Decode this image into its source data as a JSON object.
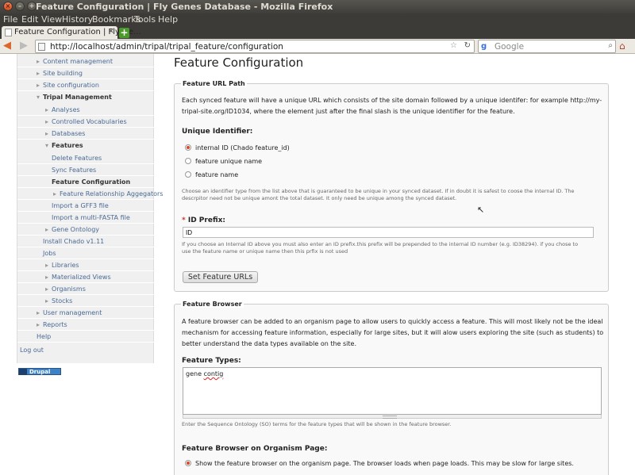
{
  "window": {
    "title": "Feature Configuration | Fly Genes Database - Mozilla Firefox"
  },
  "menu": [
    "File",
    "Edit",
    "View",
    "History",
    "Bookmarks",
    "Tools",
    "Help"
  ],
  "tab": {
    "title": "Feature Configuration | Fly Ge...",
    "close": "×",
    "new_tab": "+"
  },
  "nav": {
    "url": "http://localhost/admin/tripal/tripal_feature/configuration",
    "search_placeholder": "Google"
  },
  "sidebar": {
    "items": [
      {
        "label": "Content management",
        "arrow": "▸"
      },
      {
        "label": "Site building",
        "arrow": "▸"
      },
      {
        "label": "Site configuration",
        "arrow": "▸"
      },
      {
        "label": "Tripal Management",
        "arrow": "▾"
      },
      {
        "label": "Analyses",
        "arrow": "▸"
      },
      {
        "label": "Controlled Vocabularies",
        "arrow": "▸"
      },
      {
        "label": "Databases",
        "arrow": "▸"
      },
      {
        "label": "Features",
        "arrow": "▾"
      },
      {
        "label": "Delete Features"
      },
      {
        "label": "Sync Features"
      },
      {
        "label": "Feature Configuration"
      },
      {
        "label": "Feature Relationship Aggegators",
        "arrow": "▸"
      },
      {
        "label": "Import a GFF3 file"
      },
      {
        "label": "Import a multi-FASTA file"
      },
      {
        "label": "Gene Ontology",
        "arrow": "▸"
      },
      {
        "label": "Install Chado v1.11"
      },
      {
        "label": "Jobs"
      },
      {
        "label": "Libraries",
        "arrow": "▸"
      },
      {
        "label": "Materialized Views",
        "arrow": "▸"
      },
      {
        "label": "Organisms",
        "arrow": "▸"
      },
      {
        "label": "Stocks",
        "arrow": "▸"
      },
      {
        "label": "User management",
        "arrow": "▸"
      },
      {
        "label": "Reports",
        "arrow": "▸"
      },
      {
        "label": "Help"
      },
      {
        "label": "Log out"
      }
    ],
    "badge": "Drupal"
  },
  "page": {
    "title": "Feature Configuration"
  },
  "url_path": {
    "legend": "Feature URL Path",
    "intro_1": "Each synced feature will have a unique URL which consists of the site domain followed by a unique identifer: for example http://my-",
    "intro_2": "tripal-site.org/ID1034, where the element just after the final slash is the unique identifier for the feature.",
    "uid_label": "Unique Identifier:",
    "options": [
      "internal ID (Chado feature_id)",
      "feature unique name",
      "feature name"
    ],
    "uid_desc_1": "Choose an identifier type from the list above that is guaranteed to be unique in your synced dataset. If in doubt it is safest to coose the internal ID. The",
    "uid_desc_2": "descrpitor need not be unique amont the total dataset. It only need be unique among the synced dataset.",
    "prefix_required": "*",
    "prefix_label": "ID Prefix:",
    "prefix_value": "ID",
    "prefix_desc_1": "If you choose an Internal ID above you must also enter an ID prefix.this prefix will be prepended to the internal ID number (e.g. ID38294). if you chose to",
    "prefix_desc_2": "use the feature name or unique name then this prfix is not used",
    "button": "Set Feature URLs"
  },
  "browser": {
    "legend": "Feature Browser",
    "intro_1": "A feature browser can be added to an organism page to allow users to quickly access a feature. This will most likely not be the ideal",
    "intro_2": "mechanism for accessing feature information, especially for large sites, but it will alow users exploring the site (such as students) to",
    "intro_3": "better understand the data types available on the site.",
    "types_label": "Feature Types:",
    "types_word_1": "gene",
    "types_word_2": "contig",
    "types_desc": "Enter the Sequence Ontology (SO) terms for the feature types that will be shown in the feature browser.",
    "org_label": "Feature Browser on Organism Page:",
    "org_option": "Show the feature browser on the organism page. The browser loads when page loads. This may be slow for large sites."
  }
}
